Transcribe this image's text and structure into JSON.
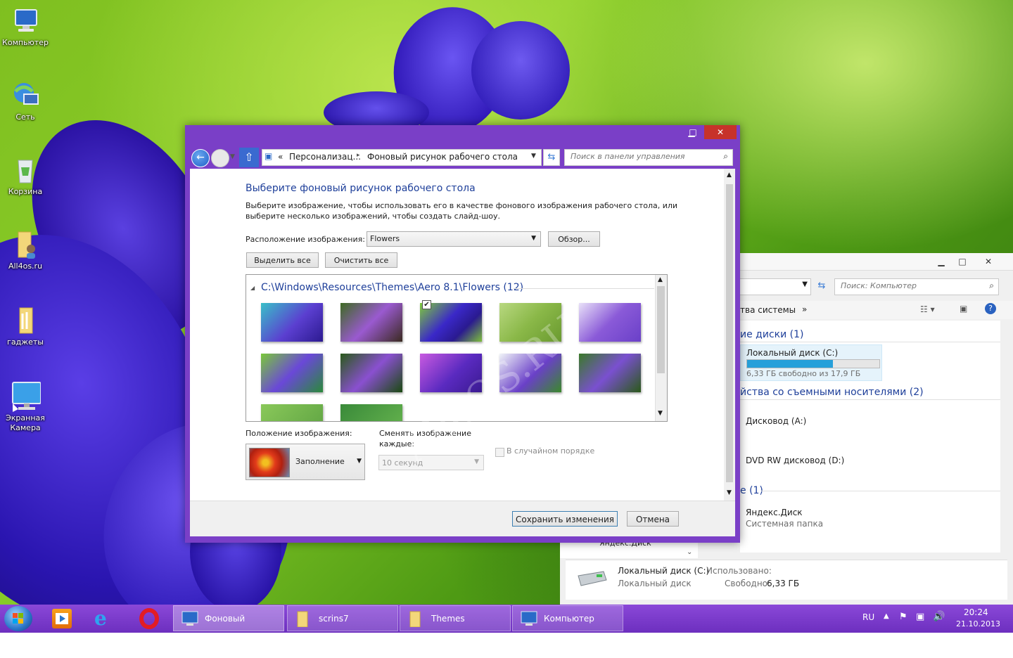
{
  "desktop_icons": [
    {
      "label": "Компьютер"
    },
    {
      "label": "Сеть"
    },
    {
      "label": "Корзина"
    },
    {
      "label": "All4os.ru"
    },
    {
      "label": "гаджеты"
    },
    {
      "label": "Экранная Камера"
    }
  ],
  "watermark": "All4OS.RU",
  "explorer": {
    "search_placeholder": "Поиск: Компьютер",
    "toolbar_item": "тва системы",
    "toolbar_more": "»",
    "group_hdd": "ие диски (1)",
    "disk_c_name": "Локальный диск (C:)",
    "disk_c_free": "6,33 ГБ свободно из 17,9 ГБ",
    "disk_c_usage": 0.65,
    "group_removable": "йства со съемными носителями (2)",
    "drive_a": "Дисковод (A:)",
    "drive_d": "DVD RW дисковод (D:)",
    "group_other": "е (1)",
    "yandex_name": "Яндекс.Диск",
    "yandex_type": "Системная папка",
    "nav_partial": "Яндекс.Диск",
    "status": {
      "name": "Локальный диск (C:)",
      "type": "Локальный диск",
      "used_label": "Использовано:",
      "free_label": "Свободно:",
      "free_value": "6,33 ГБ"
    }
  },
  "dialog": {
    "breadcrumb": {
      "sep": "«",
      "item1": "Персонализац...",
      "item2": "Фоновый рисунок рабочего стола"
    },
    "search_placeholder": "Поиск в панели управления",
    "title": "Выберите фоновый рисунок рабочего стола",
    "description_line1": "Выберите изображение, чтобы использовать его в качестве фонового изображения рабочего стола, или",
    "description_line2": "выберите несколько изображений, чтобы создать слайд-шоу.",
    "location_label": "Расположение изображения:",
    "location_value": "Flowers",
    "browse_button": "Обзор...",
    "select_all_button": "Выделить все",
    "clear_all_button": "Очистить все",
    "group_header": "C:\\Windows\\Resources\\Themes\\Aero 8.1\\Flowers (12)",
    "selected_index": 2,
    "position_label": "Положение изображения:",
    "position_value": "Заполнение",
    "interval_label_line1": "Сменять изображение",
    "interval_label_line2": "каждые:",
    "interval_value": "10 секунд",
    "shuffle_label": "В случайном порядке",
    "save_button": "Сохранить изменения",
    "cancel_button": "Отмена"
  },
  "taskbar": {
    "items": [
      {
        "label": "Фоновый рисуно..."
      },
      {
        "label": "scrins7"
      },
      {
        "label": "Themes"
      },
      {
        "label": "Компьютер"
      }
    ],
    "lang": "RU",
    "time": "20:24",
    "date": "21.10.2013"
  },
  "colors": {
    "accent_purple": "#7a3fc7",
    "title_blue": "#1e3f9a",
    "close_red": "#c7322a",
    "progress_blue": "#26a0da"
  }
}
